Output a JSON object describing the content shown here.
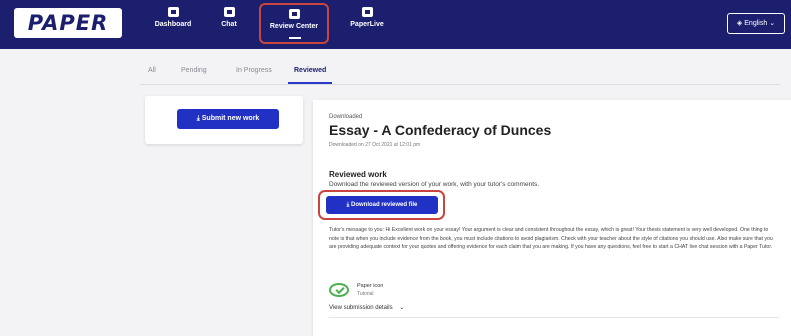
{
  "header": {
    "logo_text": "PAPER",
    "nav": [
      {
        "label": "Dashboard",
        "icon": "dashboard-icon"
      },
      {
        "label": "Chat",
        "icon": "chat-icon"
      },
      {
        "label": "Review Center",
        "icon": "review-center-icon"
      },
      {
        "label": "PaperLive",
        "icon": "paperlive-icon"
      }
    ],
    "language": "English",
    "language_icon": "globe-icon",
    "colors": {
      "nav_bg": "#1c1f6e",
      "highlight": "#c9453f",
      "primary": "#2031c4"
    }
  },
  "tabs": [
    "All",
    "Pending",
    "In Progress",
    "Reviewed"
  ],
  "active_tab": "Reviewed",
  "left_panel": {
    "submit_button": "Submit new work"
  },
  "submission": {
    "status": "Downloaded",
    "title": "Essay - A Confederacy of Dunces",
    "reviewed_title": "Reviewed work",
    "reviewed_subtitle": "Download the reviewed version of your work, with your tutor's comments.",
    "download_button": "Download reviewed file",
    "tutor_message": "Tutor's message to you: Hi Excellent work on your essay! Your argument is clear and consistent throughout the essay, which is great! Your thesis statement is very well developed. One thing to note is that when you include evidence from the book, you must include citations to avoid plagiarism. Check with your teacher about the style of citations you should use. Also make sure that you are providing adequate context for your quotes and offering evidence for each claim that you are making. If you have any questions, feel free to start a CHAT live chat session with a Paper Tutor.",
    "feedback_title": "Paper icon",
    "feedback_role": "Tutorial",
    "details_label": "View submission details"
  }
}
